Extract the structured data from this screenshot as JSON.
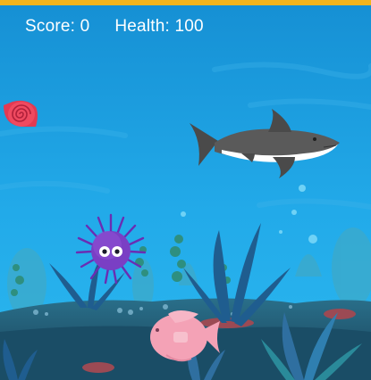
{
  "hud": {
    "score_label": "Score:",
    "score_value": "0",
    "health_label": "Health:",
    "health_value": "100"
  },
  "colors": {
    "top_bar": "#f3b41c",
    "water_top": "#1593d6",
    "water_bottom": "#2ab5ef",
    "hud_text": "#ffffff"
  },
  "sprites": {
    "shark": "shark",
    "player": "purple-sea-urchin",
    "snail": "red-snail-shell",
    "pink_fish": "pink-fish"
  }
}
